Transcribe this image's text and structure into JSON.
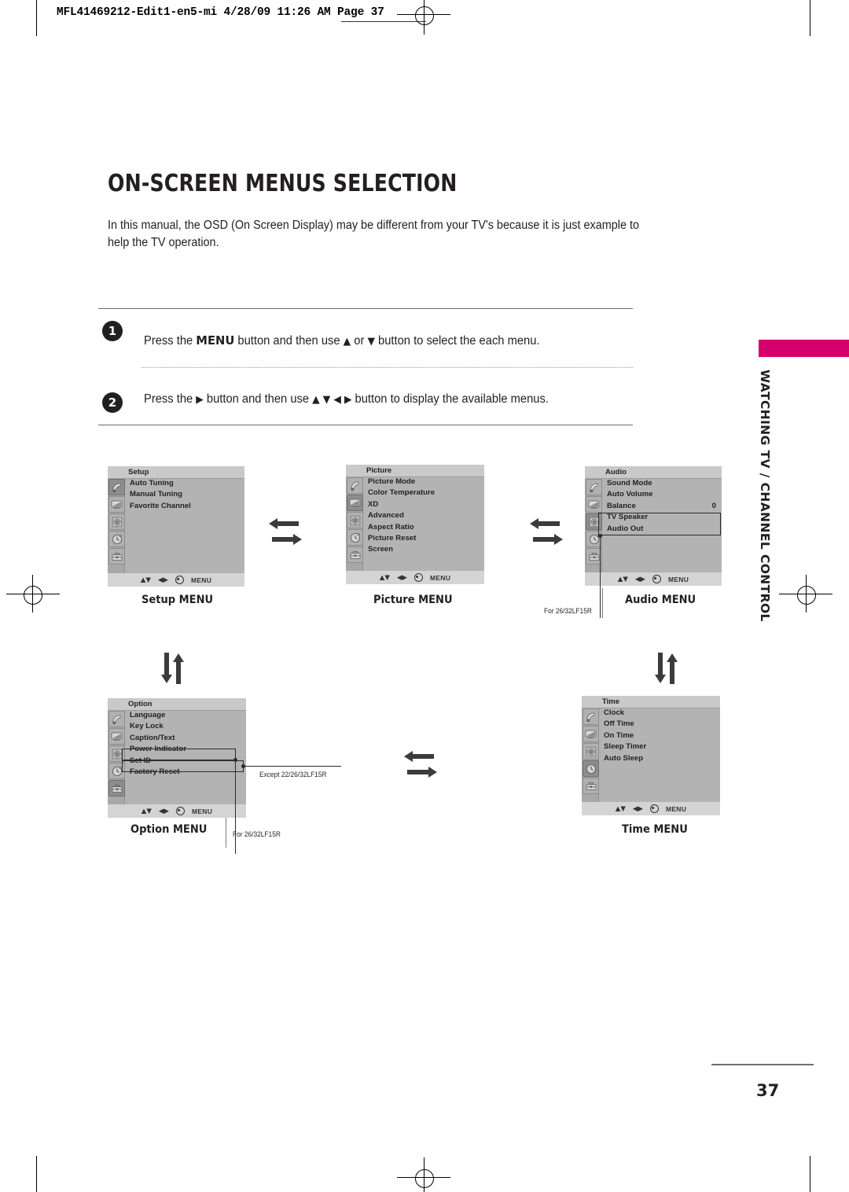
{
  "print_imprint": "MFL41469212-Edit1-en5-mi  4/28/09 11:26 AM  Page 37",
  "page": {
    "title": "ON-SCREEN MENUS SELECTION",
    "intro": "In this manual, the OSD (On Screen Display) may be different from your TV's because it is just example to help the TV operation.",
    "page_number": "37",
    "side_tab": "WATCHING TV / CHANNEL CONTROL",
    "accent_color": "#d4006b"
  },
  "steps": [
    {
      "number": "1",
      "text_parts": {
        "a": "Press the ",
        "bold": "MENU",
        "b": " button and then use ",
        "gly1": "▲",
        "c": " or ",
        "gly2": "▼",
        "d": " button to select the each menu."
      }
    },
    {
      "number": "2",
      "text_parts": {
        "a": "Press the ",
        "gly1": "▶",
        "b": " button and then use ",
        "gly2": "▲",
        "gly3": "▼",
        "gly4": "◀",
        "gly5": "▶",
        "c": " button to display the available menus."
      }
    }
  ],
  "osd_footer": {
    "updown": "▲▼",
    "leftright": "◀▶",
    "ok_icon": "ok-dot-icon",
    "menu_label": "MENU"
  },
  "rail_icons": [
    "satellite-dish-icon",
    "tv-screen-icon",
    "speaker-icon",
    "clock-icon",
    "toolbox-icon"
  ],
  "menus": [
    {
      "id": "setup",
      "title": "Setup",
      "caption": "Setup MENU",
      "active_icon_index": 0,
      "items": [
        {
          "label": "Auto Tuning"
        },
        {
          "label": "Manual Tuning"
        },
        {
          "label": "Favorite Channel"
        }
      ]
    },
    {
      "id": "picture",
      "title": "Picture",
      "caption": "Picture MENU",
      "active_icon_index": 1,
      "items": [
        {
          "label": "Picture Mode"
        },
        {
          "label": "Color Temperature"
        },
        {
          "label": "XD"
        },
        {
          "label": "Advanced"
        },
        {
          "label": "Aspect Ratio"
        },
        {
          "label": "Picture Reset"
        },
        {
          "label": "Screen"
        }
      ]
    },
    {
      "id": "audio",
      "title": "Audio",
      "caption": "Audio MENU",
      "active_icon_index": 2,
      "items": [
        {
          "label": "Sound Mode"
        },
        {
          "label": "Auto Volume"
        },
        {
          "label": "Balance",
          "value": "0"
        },
        {
          "label": "TV Speaker"
        },
        {
          "label": "Audio Out"
        }
      ]
    },
    {
      "id": "option",
      "title": "Option",
      "caption": "Option MENU",
      "active_icon_index": 4,
      "items": [
        {
          "label": "Language"
        },
        {
          "label": "Key Lock"
        },
        {
          "label": "Caption/Text"
        },
        {
          "label": "Power Indicator"
        },
        {
          "label": "Set ID"
        },
        {
          "label": "Factory Reset"
        }
      ]
    },
    {
      "id": "time",
      "title": "Time",
      "caption": "Time MENU",
      "active_icon_index": 3,
      "items": [
        {
          "label": "Clock"
        },
        {
          "label": "Off Time"
        },
        {
          "label": "On Time"
        },
        {
          "label": "Sleep Timer"
        },
        {
          "label": "Auto Sleep"
        }
      ]
    }
  ],
  "annotations": {
    "picture_model_note": "For 26/32LF15R",
    "option_model_note": "For 26/32LF15R",
    "except_note": "Except 22/26/32LF15R"
  }
}
